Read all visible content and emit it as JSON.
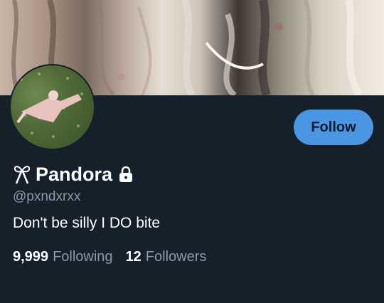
{
  "profile": {
    "display_name": "Pandora",
    "handle": "@pxndxrxx",
    "bio": "Don't be silly I DO bite",
    "follow_label": "Follow",
    "following_count": "9,999",
    "following_label": "Following",
    "followers_count": "12",
    "followers_label": "Followers",
    "name_emoji_icon": "ribbon-icon",
    "protected_icon": "lock-icon"
  },
  "colors": {
    "background": "#15202b",
    "accent": "#4a96e3",
    "text_primary": "#ffffff",
    "text_secondary": "#8b98a5"
  }
}
